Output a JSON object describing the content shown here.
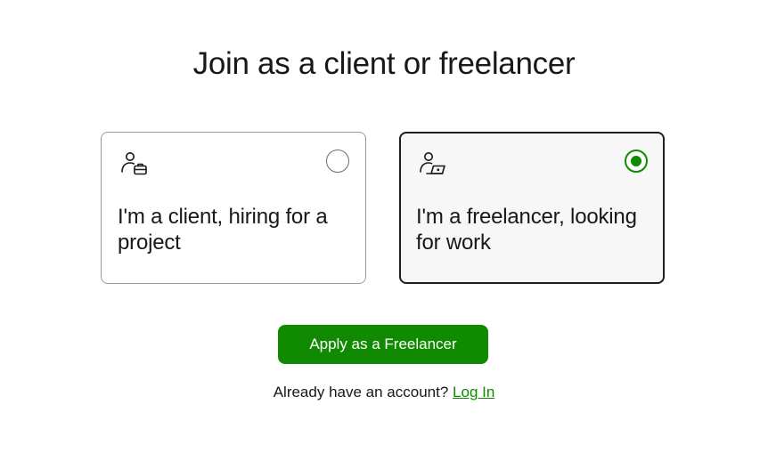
{
  "page": {
    "title": "Join as a client or freelancer"
  },
  "options": [
    {
      "id": "client",
      "label": "I'm a client, hiring for a project",
      "icon": "client-briefcase-icon",
      "selected": false
    },
    {
      "id": "freelancer",
      "label": "I'm a freelancer, looking for work",
      "icon": "freelancer-laptop-icon",
      "selected": true
    }
  ],
  "actions": {
    "primary_label": "Apply as a Freelancer",
    "login_prompt": "Already have an account?",
    "login_link": "Log In"
  },
  "colors": {
    "brand": "#108a00",
    "text": "#181818",
    "selected_card_bg": "#f7f7f7",
    "selected_card_border": "#1f1f1f",
    "card_border": "#9a9a9a"
  }
}
